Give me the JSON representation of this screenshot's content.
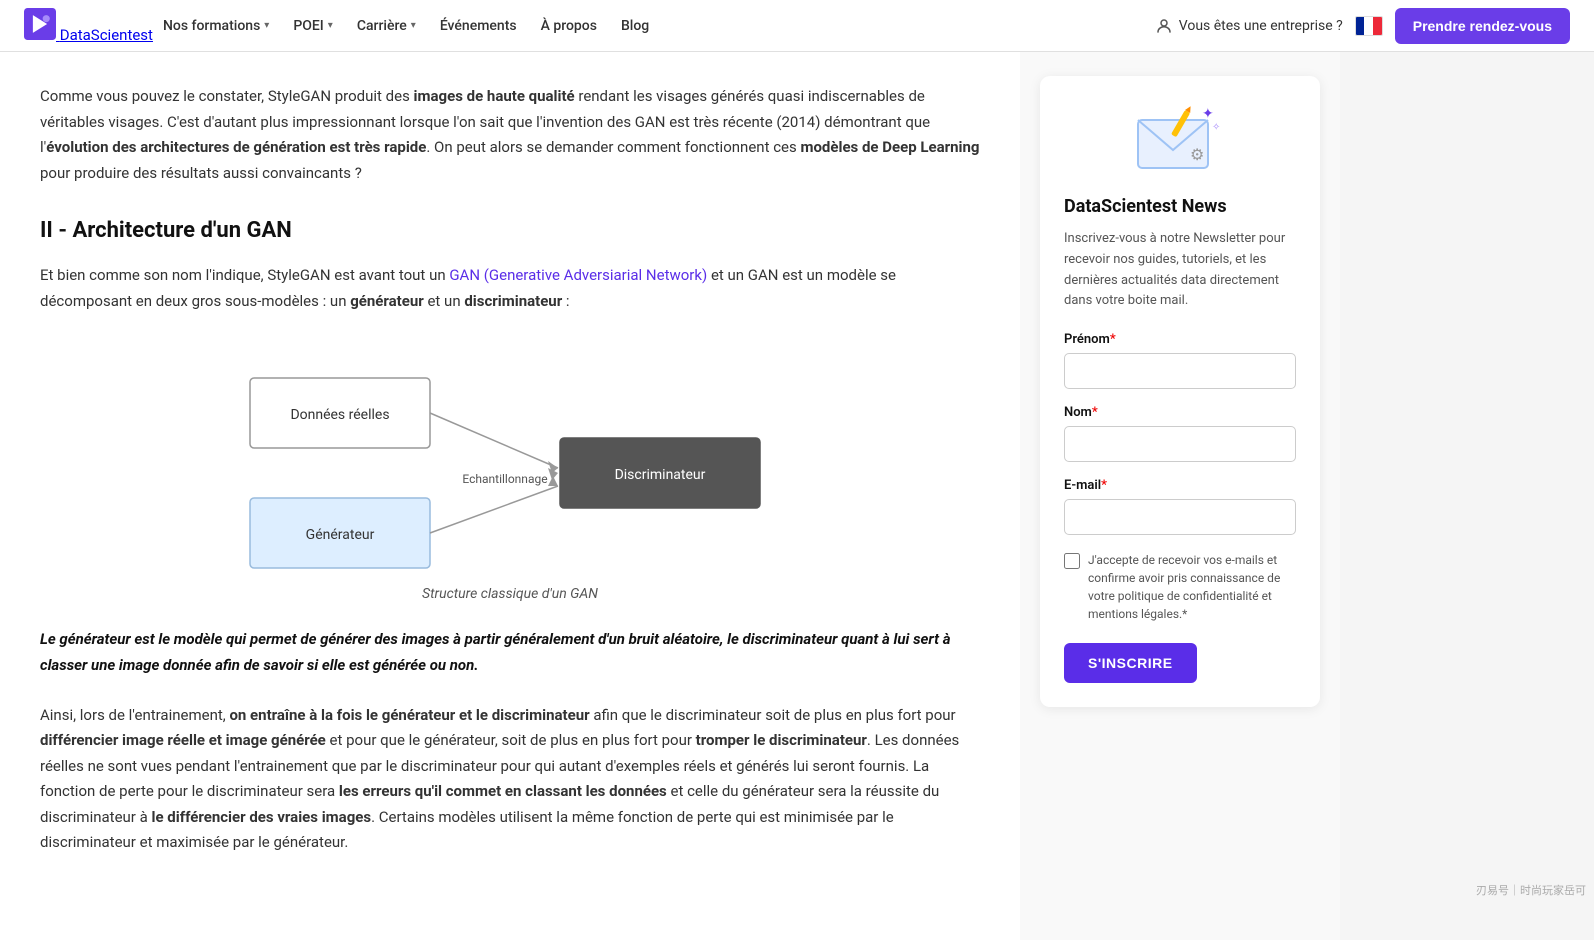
{
  "nav": {
    "logo_text": "DataScientest",
    "links": [
      {
        "label": "Nos formations",
        "has_dropdown": true
      },
      {
        "label": "POEI",
        "has_dropdown": true
      },
      {
        "label": "Carrière",
        "has_dropdown": true
      },
      {
        "label": "Événements",
        "has_dropdown": false
      },
      {
        "label": "À propos",
        "has_dropdown": false
      },
      {
        "label": "Blog",
        "has_dropdown": false
      }
    ],
    "enterprise_label": "Vous êtes une entreprise ?",
    "cta_label": "Prendre rendez-vous"
  },
  "article": {
    "paragraph1": "Comme vous pouvez le constater, StyleGAN produit des ",
    "paragraph1_bold1": "images de haute qualité",
    "paragraph1_rest": " rendant les visages générés quasi indiscernables de véritables visages. C'est d'autant plus impressionnant lorsque l'on sait que l'invention des GAN est très récente (2014) démontrant que l'",
    "paragraph1_bold2": "évolution des architectures de génération est très rapide",
    "paragraph1_end": ". On peut alors se demander comment fonctionnent ces ",
    "paragraph1_bold3": "modèles de Deep Learning",
    "paragraph1_end2": " pour produire des résultats aussi convaincants ?",
    "section2_title": "II - Architecture d'un GAN",
    "paragraph2_start": "Et bien comme son nom l'indique, StyleGAN est avant tout un ",
    "paragraph2_link": "GAN (Generative Adversiarial Network)",
    "paragraph2_rest": " et un GAN est un modèle se décomposant en deux gros sous-modèles : un ",
    "paragraph2_bold1": "générateur",
    "paragraph2_mid": " et un ",
    "paragraph2_bold2": "discriminateur",
    "paragraph2_end": " :",
    "diagram_caption": "Structure classique d'un GAN",
    "diagram_labels": {
      "donnees_reelles": "Données réelles",
      "echantillonnage": "Echantillonnage",
      "discriminateur": "Discriminateur",
      "generateur": "Générateur"
    },
    "blockquote": "Le générateur est le modèle qui permet de générer des images à partir généralement d'un bruit aléatoire, le discriminateur quant à lui sert à classer une image donnée afin de savoir si elle est générée ou non.",
    "paragraph3_start": "Ainsi, lors de l'entrainement, ",
    "paragraph3_bold1": "on entraîne à la fois le générateur et le discriminateur",
    "paragraph3_rest1": " afin que le discriminateur soit de plus en plus fort pour ",
    "paragraph3_bold2": "différencier image réelle et image générée",
    "paragraph3_rest2": " et pour que le générateur, soit de plus en plus fort pour ",
    "paragraph3_bold3": "tromper le discriminateur",
    "paragraph3_rest3": ". Les données réelles ne sont vues pendant l'entrainement que par le discriminateur pour qui autant d'exemples réels et générés lui seront fournis. La fonction de perte pour le discriminateur sera ",
    "paragraph3_bold4": "les erreurs qu'il commet en classant les données",
    "paragraph3_rest4": " et celle du générateur sera la réussite du discriminateur à ",
    "paragraph3_bold5": "le différencier des vraies images",
    "paragraph3_end": ". Certains modèles utilisent la même fonction de perte qui est minimisée par le discriminateur et maximisée par le générateur."
  },
  "sidebar": {
    "title": "DataScientest News",
    "description": "Inscrivez-vous à notre Newsletter pour recevoir nos guides, tutoriels, et les dernières actualités data directement dans votre boite mail.",
    "prenom_label": "Prénom",
    "nom_label": "Nom",
    "email_label": "E-mail",
    "required_star": "*",
    "checkbox_label": "J'accepte de recevoir vos e-mails et confirme avoir pris connaissance de votre politique de confidentialité et mentions légales.*",
    "submit_label": "S'INSCRIRE",
    "prenom_placeholder": "",
    "nom_placeholder": "",
    "email_placeholder": ""
  },
  "watermark": "刃易号｜时尚玩家岳可"
}
